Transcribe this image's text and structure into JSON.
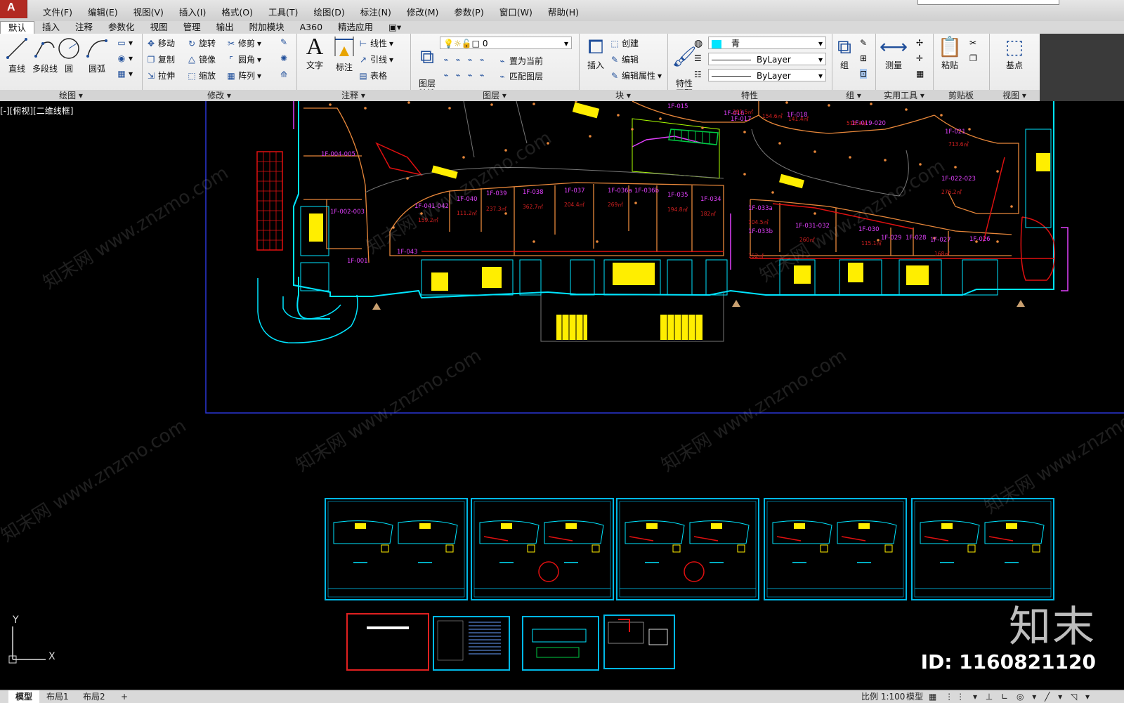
{
  "app": {
    "logo_letter": "A"
  },
  "menu": [
    "文件(F)",
    "编辑(E)",
    "视图(V)",
    "插入(I)",
    "格式(O)",
    "工具(T)",
    "绘图(D)",
    "标注(N)",
    "修改(M)",
    "参数(P)",
    "窗口(W)",
    "帮助(H)"
  ],
  "ribbon_tabs": [
    "默认",
    "插入",
    "注释",
    "参数化",
    "视图",
    "管理",
    "输出",
    "附加模块",
    "A360",
    "精选应用",
    "▣▾"
  ],
  "active_tab": "默认",
  "panels": {
    "draw": {
      "title": "绘图 ▾",
      "line": "直线",
      "polyline": "多段线",
      "circle": "圆",
      "arc": "圆弧"
    },
    "modify": {
      "title": "修改 ▾",
      "move": "移动",
      "rotate": "旋转",
      "trim": "修剪",
      "copy": "复制",
      "mirror": "镜像",
      "fillet": "圆角",
      "stretch": "拉伸",
      "scale": "缩放",
      "array": "阵列"
    },
    "annotation": {
      "title": "注释 ▾",
      "text": "文字",
      "dimension": "标注",
      "linetype": "线性",
      "leader": "引线",
      "table": "表格"
    },
    "layers": {
      "title": "图层 ▾",
      "props": "图层\n特性",
      "layer_value": "0",
      "set_current": "置为当前",
      "match": "匹配图层"
    },
    "block": {
      "title": "块 ▾",
      "insert": "插入",
      "create": "创建",
      "edit": "编辑",
      "edit_attr": "编辑属性"
    },
    "properties": {
      "title": "特性",
      "match": "特性\n匹配",
      "color": "青",
      "linetype": "ByLayer",
      "lineweight": "ByLayer"
    },
    "group": {
      "title": "组 ▾",
      "group": "组"
    },
    "utilities": {
      "title": "实用工具 ▾",
      "measure": "测量"
    },
    "clipboard": {
      "title": "剪贴板",
      "paste": "粘贴"
    },
    "view": {
      "title": "视图 ▾",
      "base": "基点"
    }
  },
  "viewport": {
    "label": "[-][俯视][二维线框]"
  },
  "drawing": {
    "room_labels": [
      "1F-015",
      "1F-016",
      "1F-017",
      "1F-018",
      "1F-019-020",
      "1F-021",
      "1F-022-023",
      "1F-033a",
      "1F-033b",
      "1F-031-032",
      "1F-030",
      "1F-029",
      "1F-028",
      "1F-027",
      "1F-026",
      "1F-034",
      "1F-035",
      "1F-036a",
      "1F-036b",
      "1F-037",
      "1F-038",
      "1F-039",
      "1F-040",
      "1F-041-042",
      "1F-043",
      "1F-004-005",
      "1F-002-003",
      "1F-001"
    ],
    "area_labels": [
      "291.5㎡",
      "154.6㎡",
      "141.4㎡",
      "518.3㎡",
      "713.6㎡",
      "276.2㎡",
      "104.5㎡",
      "152㎡",
      "260㎡",
      "115.1㎡",
      "168㎡",
      "182㎡",
      "194.8㎡",
      "269㎡",
      "204.4㎡",
      "362.7㎡",
      "237.3㎡",
      "111.2㎡",
      "159.2㎡"
    ]
  },
  "axis": {
    "y": "Y",
    "x": "X"
  },
  "status": {
    "tabs": [
      "模型",
      "布局1",
      "布局2",
      "+"
    ],
    "scale": "比例 1:100",
    "mode": "模型"
  },
  "watermark": {
    "site": "知末网 www.znzmo.com",
    "brand": "知末",
    "id": "ID: 1160821120"
  },
  "colors": {
    "ribbon_bg": "#ececec",
    "viewport_bg": "#000000",
    "cyan": "#00e5ff",
    "orange": "#e8873a",
    "magenta": "#e040fb",
    "yellow": "#ffee00",
    "red": "#e01010"
  }
}
